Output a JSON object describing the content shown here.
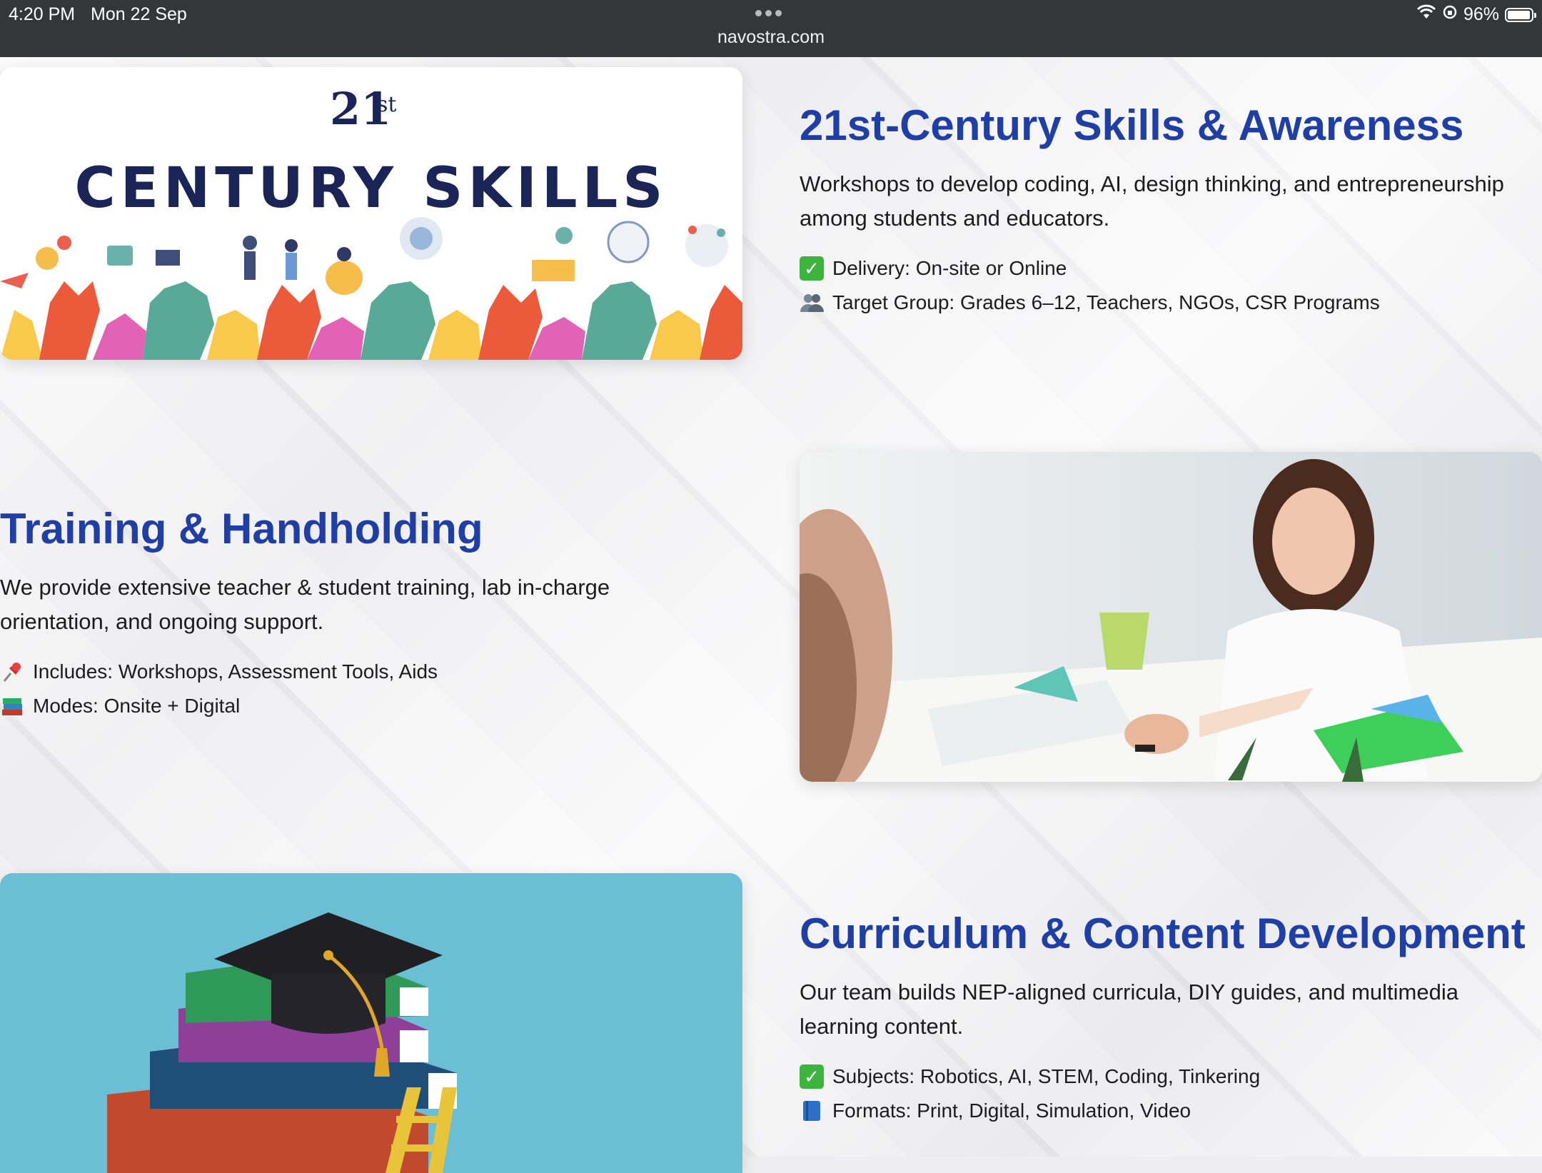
{
  "status_bar": {
    "time": "4:20 PM",
    "date": "Mon 22 Sep",
    "url": "navostra.com",
    "battery": "96%",
    "battery_level": 0.96
  },
  "sections": [
    {
      "title": "21st-Century Skills & Awareness",
      "description": "Workshops to develop coding, AI, design thinking, and entrepreneurship among students and educators.",
      "bullets": [
        {
          "icon": "check-icon",
          "text": "Delivery: On-site or Online"
        },
        {
          "icon": "people-icon",
          "text": "Target Group: Grades 6–12, Teachers, NGOs, CSR Programs"
        }
      ],
      "image": {
        "heading_sup": "21st",
        "heading": "CENTURY SKILLS"
      }
    },
    {
      "title": "Training & Handholding",
      "description": "We provide extensive teacher & student training, lab in-charge orientation, and ongoing support.",
      "bullets": [
        {
          "icon": "pushpin-icon",
          "text": "Includes: Workshops, Assessment Tools, Aids"
        },
        {
          "icon": "books-icon",
          "text": "Modes: Onsite + Digital"
        }
      ]
    },
    {
      "title": "Curriculum & Content Development",
      "description": "Our team builds NEP-aligned curricula, DIY guides, and multimedia learning content.",
      "bullets": [
        {
          "icon": "check-icon",
          "text": "Subjects: Robotics, AI, STEM, Coding, Tinkering"
        },
        {
          "icon": "blue-book-icon",
          "text": "Formats: Print, Digital, Simulation, Video"
        }
      ]
    }
  ],
  "colors": {
    "title": "#1f3ea6",
    "status_bar": "#353638",
    "check_green": "#3db43d",
    "teal_bg": "#6bbfd4"
  }
}
